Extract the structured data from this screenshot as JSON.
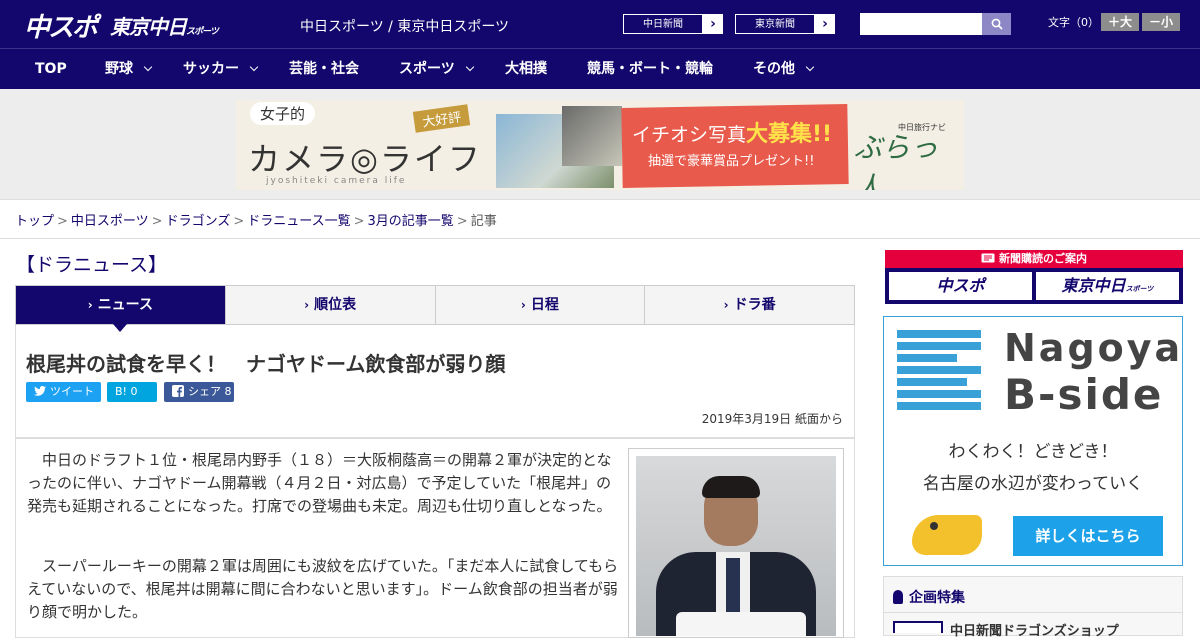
{
  "header": {
    "logo_main": "中スポ",
    "logo_sub": "東京中日",
    "logo_sub_small": "スポーツ",
    "site_title": "中日スポーツ / 東京中日スポーツ",
    "ext_links": [
      {
        "label": "中日新聞",
        "arrow": "›"
      },
      {
        "label": "東京新聞",
        "arrow": "›"
      }
    ],
    "search_placeholder": "",
    "font_size_label": "文字（0）",
    "font_larger": "＋大",
    "font_smaller": "－小"
  },
  "nav": {
    "items": [
      {
        "label": "TOP",
        "dropdown": false
      },
      {
        "label": "野球",
        "dropdown": true
      },
      {
        "label": "サッカー",
        "dropdown": true
      },
      {
        "label": "芸能・社会",
        "dropdown": false
      },
      {
        "label": "スポーツ",
        "dropdown": true
      },
      {
        "label": "大相撲",
        "dropdown": false
      },
      {
        "label": "競馬・ボート・競輪",
        "dropdown": false
      },
      {
        "label": "その他",
        "dropdown": true
      }
    ]
  },
  "banner": {
    "girl": "女子的",
    "camera_life": "カメラ◎ライフ",
    "subtitle": "jyoshiteki camera life",
    "tag": "大好評",
    "headline_prefix": "イチオシ写真",
    "headline_highlight": "大募集!!",
    "prize": "抽選で豪華賞品プレゼント!!",
    "brand": "ぶらっ人",
    "brand_small": "中日旅行ナビ"
  },
  "breadcrumb": {
    "items": [
      "トップ",
      "中日スポーツ",
      "ドラゴンズ",
      "ドラニュース一覧",
      "3月の記事一覧"
    ],
    "current": "記事",
    "separator": ">"
  },
  "section_title": "【ドラニュース】",
  "tabs": [
    {
      "label": "ニュース",
      "active": true
    },
    {
      "label": "順位表",
      "active": false
    },
    {
      "label": "日程",
      "active": false
    },
    {
      "label": "ドラ番",
      "active": false
    }
  ],
  "article": {
    "headline": "根尾丼の試食を早く！　ナゴヤドーム飲食部が弱り顔",
    "share": {
      "tweet": "ツイート",
      "hatena": "B! 0",
      "facebook": "シェア 8"
    },
    "dateline": "2019年3月19日 紙面から",
    "paragraphs": [
      "　中日のドラフト１位・根尾昂内野手（１８）＝大阪桐蔭高＝の開幕２軍が決定的となったのに伴い、ナゴヤドーム開幕戦（４月２日・対広島）で予定していた「根尾丼」の発売も延期されることになった。打席での登場曲も未定。周辺も仕切り直しとなった。",
      "　スーパールーキーの開幕２軍は周囲にも波紋を広げていた。「まだ本人に試食してもらえていないので、根尾丼は開幕に間に合わないと思います」。ドーム飲食部の担当者が弱り顔で明かした。"
    ]
  },
  "sidebar": {
    "subscribe_head": "新聞購読のご案内",
    "subscribe_buttons": [
      {
        "label": "中スポ"
      },
      {
        "label": "東京中日",
        "small": "スポーツ"
      }
    ],
    "nagoya": {
      "title1": "Nagoya",
      "title2": "B-side",
      "line1": "わくわく！どきどき！",
      "line2": "名古屋の水辺が変わっていく",
      "button": "詳しくはこちら"
    },
    "feature_head": "企画特集",
    "feature_item": "中日新聞ドラゴンズショップ"
  },
  "colors": {
    "brand_navy": "#13066c",
    "accent_red": "#e5003d",
    "accent_blue": "#3aa0d8",
    "twitter": "#1da1f2",
    "hatena": "#00a4de",
    "facebook": "#3b5998"
  }
}
